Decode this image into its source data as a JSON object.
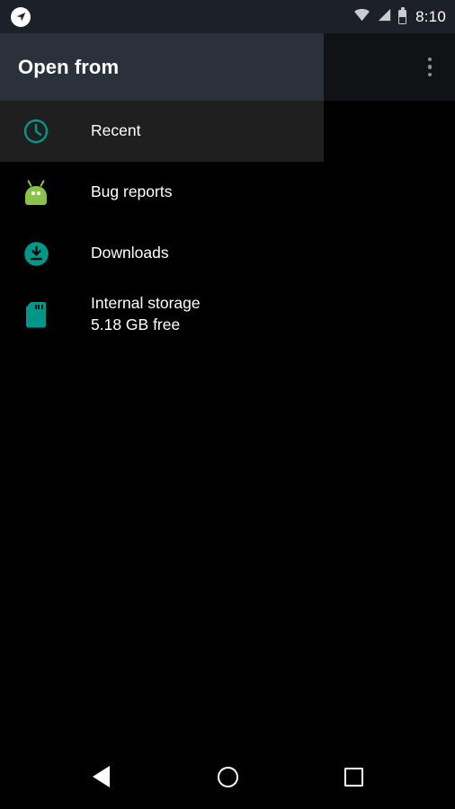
{
  "status_bar": {
    "location_icon": "navigation-arrow-icon",
    "wifi_icon": "wifi-icon",
    "signal_icon": "cell-signal-icon",
    "battery_icon": "battery-icon",
    "time": "8:10"
  },
  "toolbar": {
    "title": "Open from",
    "overflow_icon": "more-vertical-icon"
  },
  "drawer": {
    "items": [
      {
        "label": "Recent",
        "sub": "",
        "icon": "clock-icon",
        "selected": true
      },
      {
        "label": "Bug reports",
        "sub": "",
        "icon": "android-icon",
        "selected": false
      },
      {
        "label": "Downloads",
        "sub": "",
        "icon": "download-icon",
        "selected": false
      },
      {
        "label": "Internal storage",
        "sub": "5.18 GB free",
        "icon": "sd-card-icon",
        "selected": false
      }
    ]
  },
  "nav_bar": {
    "back_icon": "back-triangle-icon",
    "home_icon": "home-circle-icon",
    "recents_icon": "recents-square-icon"
  },
  "colors": {
    "status_bar_bg": "#1c2028",
    "toolbar_bg": "#2b313b",
    "toolbar_right_bg": "#101216",
    "drawer_bg": "#000000",
    "selected_row_bg": "#1f1f1f",
    "accent_teal": "#009688",
    "android_green": "#8bc34a",
    "text_primary": "#ffffff"
  }
}
